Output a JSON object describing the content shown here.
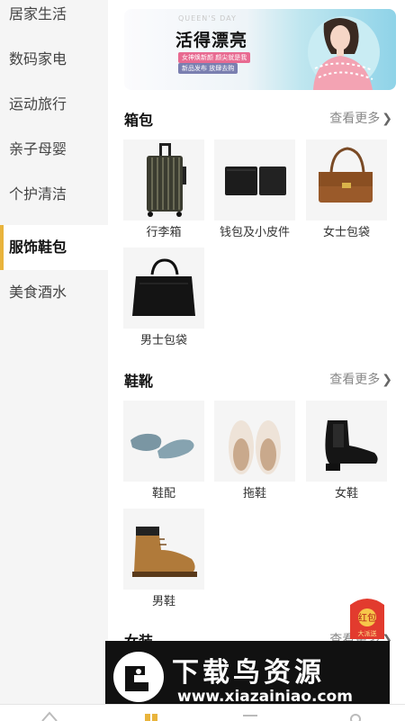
{
  "sidebar": {
    "items": [
      {
        "label": "居家生活"
      },
      {
        "label": "数码家电"
      },
      {
        "label": "运动旅行"
      },
      {
        "label": "亲子母婴"
      },
      {
        "label": "个护清洁"
      },
      {
        "label": "服饰鞋包"
      },
      {
        "label": "美食酒水"
      }
    ],
    "active_index": 5
  },
  "banner": {
    "eyebrow": "QUEEN'S DAY",
    "headline": "活得漂亮",
    "tag1": "女神焕新颜 颜尖就是我",
    "tag2": "新品发布 放肆去购",
    "tag3": "●"
  },
  "sections": [
    {
      "title": "箱包",
      "more": "查看更多",
      "items": [
        {
          "label": "行李箱",
          "icon": "suitcase-icon"
        },
        {
          "label": "钱包及小皮件",
          "icon": "wallet-icon"
        },
        {
          "label": "女士包袋",
          "icon": "handbag-icon"
        },
        {
          "label": "男士包袋",
          "icon": "briefcase-icon"
        }
      ]
    },
    {
      "title": "鞋靴",
      "more": "查看更多",
      "items": [
        {
          "label": "鞋配",
          "icon": "insole-icon"
        },
        {
          "label": "拖鞋",
          "icon": "slipper-icon"
        },
        {
          "label": "女鞋",
          "icon": "ankle-boot-icon"
        },
        {
          "label": "男鞋",
          "icon": "work-boot-icon"
        }
      ]
    },
    {
      "title": "女装",
      "more": "查看更多"
    }
  ],
  "floating": {
    "redpack_label": "红包",
    "redpack_sub": "大派送"
  },
  "watermark": {
    "title": "下载鸟资源",
    "url": "www.xiazainiao.com"
  },
  "colors": {
    "accent": "#e9b43c",
    "sidebar_bg": "#f5f5f5",
    "tile_bg": "#f5f5f5"
  }
}
